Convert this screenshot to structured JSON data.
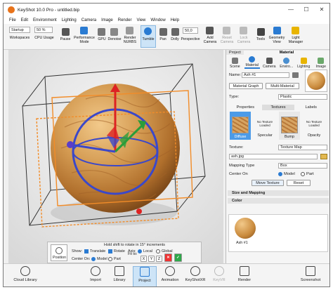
{
  "window": {
    "title": "KeyShot 10.0 Pro - untitled.bip",
    "minimize": "—",
    "maximize": "☐",
    "close": "✕"
  },
  "menu": [
    "File",
    "Edit",
    "Environment",
    "Lighting",
    "Camera",
    "Image",
    "Render",
    "View",
    "Window",
    "Help"
  ],
  "toolbar": {
    "workspace_value": "Startup",
    "cpu_value": "50 %",
    "nurbs_value": "50,0",
    "workspaces": "Workspaces",
    "cpu_usage": "CPU Usage",
    "pause": "Pause",
    "performance_mode_1": "Performance",
    "performance_mode_2": "Mode",
    "gpu": "GPU",
    "denoise": "Denoise",
    "render_nurbs_1": "Render",
    "render_nurbs_2": "NURBS",
    "tumble": "Tumble",
    "pan": "Pan",
    "dolly": "Dolly",
    "perspective": "Perspective",
    "add_camera_1": "Add",
    "add_camera_2": "Camera",
    "reset_camera_1": "Reset",
    "reset_camera_2": "Camera",
    "lock_camera_1": "Lock",
    "lock_camera_2": "Camera",
    "tools": "Tools",
    "geometry_view_1": "Geometry",
    "geometry_view_2": "View",
    "light_manager_1": "Light",
    "light_manager_2": "Manager"
  },
  "right_panel": {
    "tabs": [
      "Project",
      "Material"
    ],
    "icons": [
      "Scene",
      "Material",
      "Camera",
      "Enviro...",
      "Lighting",
      "Image"
    ],
    "name_label": "Name:",
    "name_value": "Ash #1",
    "material_graph": "Material Graph",
    "multi_material": "Multi-Material",
    "type_label": "Type:",
    "type_value": "Plastic",
    "subtabs": [
      "Properties",
      "Textures",
      "Labels"
    ],
    "textures": [
      "Diffuse",
      "Specular",
      "Bump",
      "Opacity"
    ],
    "no_texture": "No Texture Loaded",
    "texture_label": "Texture:",
    "texture_type": "Texture Map",
    "texture_file": "ash.jpg",
    "mapping_type_label": "Mapping Type",
    "mapping_type_value": "Box",
    "center_on_label": "Center On",
    "center_on_value": "Model",
    "center_on_other": "Part",
    "move_texture": "Move Texture",
    "reset": "Reset",
    "size_mapping": "Size and Mapping",
    "color": "Color",
    "thumb_name": "Ash #1"
  },
  "hud": {
    "hint": "Hold shift to rotate in 15° increments",
    "show": "Show:",
    "translate": "Translate",
    "rotate": "Rotate",
    "axis": "Axis:",
    "local": "Local",
    "global": "Global",
    "center_on": "Center On:",
    "model": "Model",
    "part": "Part",
    "fit_to": "Fit to:",
    "x": "X",
    "y": "Y",
    "z": "Z",
    "position": "Position"
  },
  "bottom": [
    "Cloud Library",
    "Import",
    "Library",
    "Project",
    "Animation",
    "KeyShotXR",
    "KeyVR",
    "Render",
    "Screenshot"
  ],
  "colors": {
    "accent": "#2a7bd2",
    "active_bg": "#cde4f7",
    "wood": "#c98a3c",
    "box_orange": "#f28c28"
  }
}
